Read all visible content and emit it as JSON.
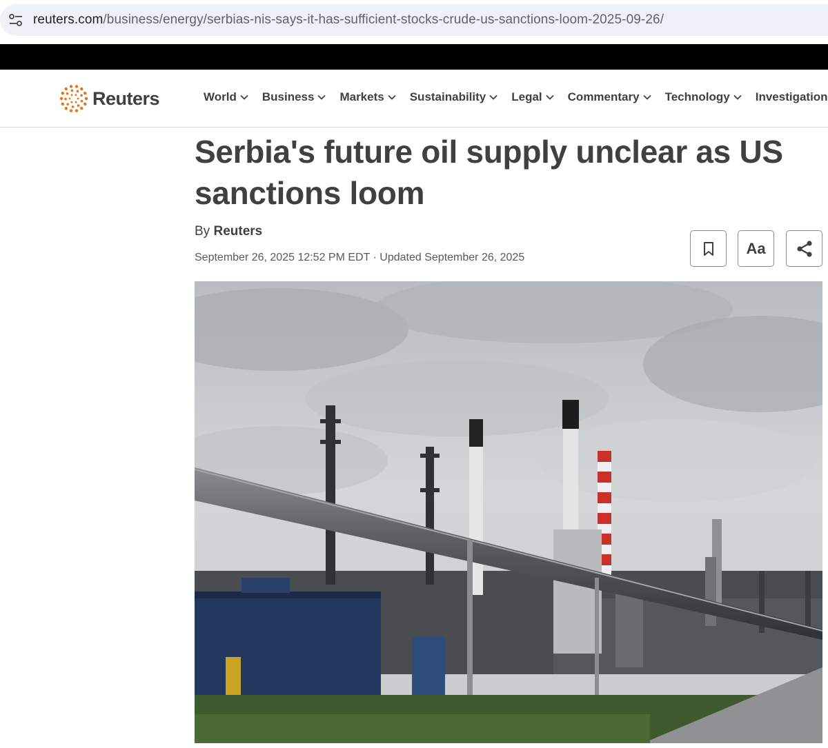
{
  "browser": {
    "url_host": "reuters.com",
    "url_path": "/business/energy/serbias-nis-says-it-has-sufficient-stocks-crude-us-sanctions-loom-2025-09-26/",
    "site_info_icon": "tune-icon"
  },
  "header": {
    "logo_text": "Reuters",
    "nav": [
      {
        "label": "World",
        "has_menu": true
      },
      {
        "label": "Business",
        "has_menu": true
      },
      {
        "label": "Markets",
        "has_menu": true
      },
      {
        "label": "Sustainability",
        "has_menu": true
      },
      {
        "label": "Legal",
        "has_menu": true
      },
      {
        "label": "Commentary",
        "has_menu": true
      },
      {
        "label": "Technology",
        "has_menu": true
      },
      {
        "label": "Investigations",
        "has_menu": false
      }
    ]
  },
  "article": {
    "headline": "Serbia's future oil supply unclear as US sanctions loom",
    "byline_prefix": "By",
    "byline_author": "Reuters",
    "dateline": "September 26, 2025 12:52 PM EDT · Updated September 26, 2025",
    "tools": {
      "bookmark_icon": "bookmark-icon",
      "text_size_label": "Aa",
      "share_icon": "share-icon"
    },
    "image_subject": "oil-refinery-photo"
  },
  "colors": {
    "logo_orange": "#e8711c",
    "text": "#404040",
    "address_bar": "#eef1f8"
  }
}
